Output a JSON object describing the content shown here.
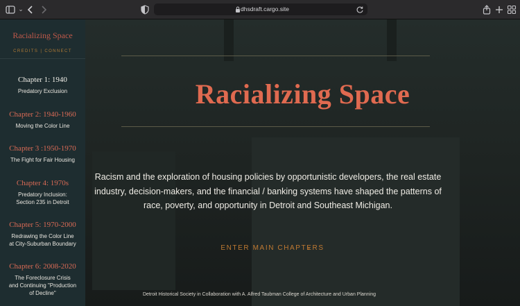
{
  "browser": {
    "url": "dhsdraft.cargo.site",
    "icons": [
      "sidebar-toggle-icon",
      "chevron-down-icon",
      "back-icon",
      "forward-icon",
      "privacy-shield-icon",
      "lock-icon",
      "reload-icon",
      "share-icon",
      "new-tab-icon",
      "tab-overview-icon"
    ]
  },
  "sidebar": {
    "brand": "Racializing Space",
    "links": "CREDITS | CONNECT",
    "chapters": [
      {
        "title": "Chapter 1: 1940",
        "subtitle": "Predatory Exclusion",
        "active": true
      },
      {
        "title": "Chapter 2: 1940-1960",
        "subtitle": "Moving the Color Line",
        "active": false
      },
      {
        "title": "Chapter 3 :1950-1970",
        "subtitle": "The Fight for Fair Housing",
        "active": false
      },
      {
        "title": "Chapter 4: 1970s",
        "subtitle": "Predatory Inclusion:\nSection 235 in Detroit",
        "active": false
      },
      {
        "title": "Chapter 5: 1970-2000",
        "subtitle": "Redrawing the Color Line\nat City-Suburban Boundary",
        "active": false
      },
      {
        "title": "Chapter 6: 2008-2020",
        "subtitle": "The Foreclosure Crisis\nand Continuing \"Production\nof Decline\"",
        "active": false
      }
    ]
  },
  "main": {
    "title": "Racializing Space",
    "body": "Racism and the exploration of housing policies by opportunistic developers, the real estate industry, decision-makers, and the financial / banking systems have shaped the patterns of race, poverty, and opportunity in Detroit and Southeast Michigan.",
    "cta": "ENTER MAIN CHAPTERS",
    "footer": "Detroit Historical Society in Collaboration with A. Alfred Taubman College of Architecture and Urban Planning"
  },
  "colors": {
    "accent": "#e06a50",
    "cta": "#c07a32",
    "sidebar_bg": "#1e2d30"
  }
}
